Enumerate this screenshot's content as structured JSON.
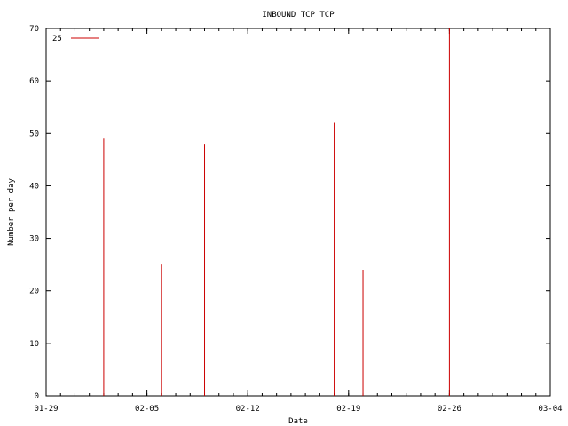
{
  "chart_data": {
    "type": "bar",
    "title": "INBOUND TCP TCP",
    "xlabel": "Date",
    "ylabel": "Number per day",
    "xlim": [
      "01-29",
      "03-04"
    ],
    "ylim": [
      0,
      70
    ],
    "x_ticks": [
      "01-29",
      "02-05",
      "02-12",
      "02-19",
      "02-26",
      "03-04"
    ],
    "y_ticks": [
      0,
      10,
      20,
      30,
      40,
      50,
      60,
      70
    ],
    "grid": false,
    "legend_position": "top-left",
    "series": [
      {
        "name": "25",
        "color": "#cc0000",
        "points": [
          {
            "x": "02-02",
            "y": 49
          },
          {
            "x": "02-06",
            "y": 25
          },
          {
            "x": "02-09",
            "y": 48
          },
          {
            "x": "02-18",
            "y": 52
          },
          {
            "x": "02-20",
            "y": 24
          },
          {
            "x": "02-26",
            "y": 70
          }
        ]
      }
    ]
  }
}
